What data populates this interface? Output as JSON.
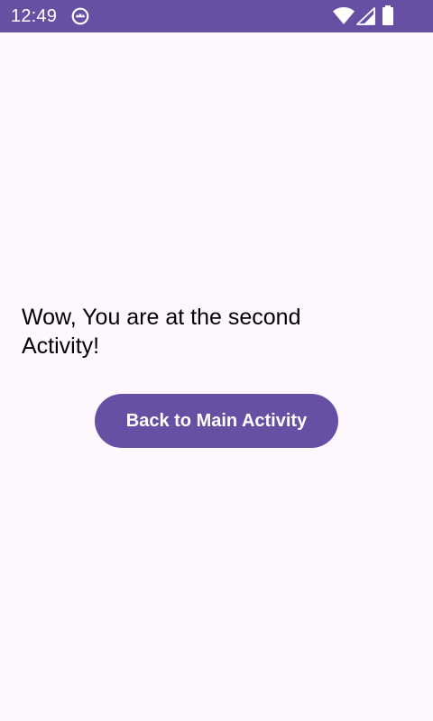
{
  "status_bar": {
    "time": "12:49",
    "notification_icon": "android-notification-icon",
    "wifi_icon": "wifi-icon",
    "signal_icon": "cell-signal-icon",
    "battery_icon": "battery-icon",
    "background_color": "#6750A4"
  },
  "main": {
    "message": "Wow, You are at the second Activity!",
    "back_button_label": "Back to Main Activity",
    "button_color": "#6750A4",
    "background_color": "#FEF7FE"
  }
}
